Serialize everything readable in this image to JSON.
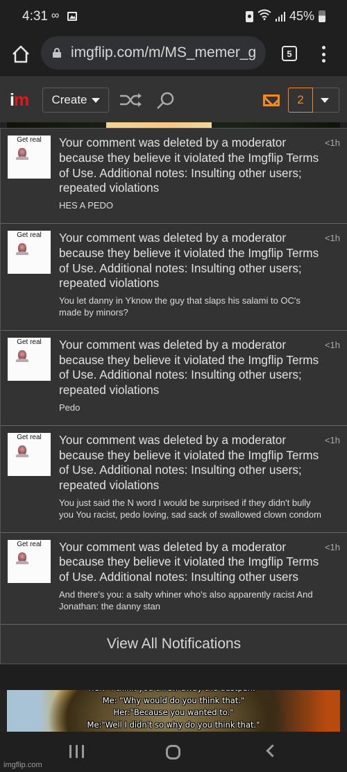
{
  "status_bar": {
    "time": "4:31",
    "voicemail_icon": "voicemail-icon",
    "gallery_icon": "image-icon",
    "battery_percent": "45%"
  },
  "browser": {
    "url": "imgflip.com/m/MS_memer_g",
    "tab_count": "5"
  },
  "header": {
    "logo_i": "i",
    "logo_m": "m",
    "create_label": "Create",
    "notification_count": "2",
    "colors": {
      "accent_orange": "#f08a24",
      "logo_red": "#e8151b"
    }
  },
  "notifications": [
    {
      "thumb_caption": "Get real",
      "message": "Your comment was deleted by a moderator because they believe it violated the Imgflip Terms of Use. Additional notes: Insulting other users; repeated violations",
      "quote": "HES A PEDO",
      "time": "<1h"
    },
    {
      "thumb_caption": "Get real",
      "message": "Your comment was deleted by a moderator because they believe it violated the Imgflip Terms of Use. Additional notes: Insulting other users; repeated violations",
      "quote": "You let danny in Yknow the guy that slaps his salami to OC's made by minors?",
      "time": "<1h"
    },
    {
      "thumb_caption": "Get real",
      "message": "Your comment was deleted by a moderator because they believe it violated the Imgflip Terms of Use. Additional notes: Insulting other users; repeated violations",
      "quote": "Pedo",
      "time": "<1h"
    },
    {
      "thumb_caption": "Get real",
      "message": "Your comment was deleted by a moderator because they believe it violated the Imgflip Terms of Use. Additional notes: Insulting other users; repeated violations",
      "quote": "You just said the N word I would be surprised if they didn't bully you You racist, pedo loving, sad sack of swallowed clown condom",
      "time": "<1h"
    },
    {
      "thumb_caption": "Get real",
      "message": "Your comment was deleted by a moderator because they believe it violated the Imgflip Terms of Use. Additional notes: Insulting other users",
      "quote": "And there's you: a salty whiner who's also apparently racist And Jonathan: the danny stan",
      "time": "<1h"
    }
  ],
  "view_all_label": "View All Notifications",
  "background_meme": {
    "lines": [
      "Her: \"I think you threw away the dustpan.\"",
      "Me: \"Why would do you think that.\"",
      "Her:\"Because you wanted to.\"",
      "Me:\"Well I didn't so why do you think that.\""
    ]
  },
  "watermark": "imgflip.com"
}
